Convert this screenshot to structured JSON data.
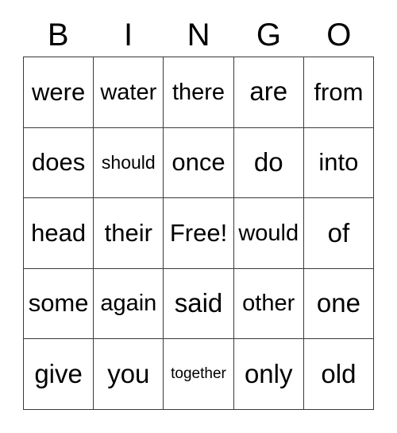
{
  "card": {
    "title": "BINGO",
    "header_letters": [
      "B",
      "I",
      "N",
      "G",
      "O"
    ],
    "free_space_label": "Free!",
    "free_space_position": {
      "row": 2,
      "column": 2
    },
    "grid_size": {
      "rows": 5,
      "columns": 5
    },
    "border_color": "#3a3a3a",
    "text_color": "#000000",
    "background_color": "#ffffff",
    "rows": [
      {
        "cells": [
          {
            "text": "were",
            "size": "lg"
          },
          {
            "text": "water",
            "size": "md"
          },
          {
            "text": "there",
            "size": "md"
          },
          {
            "text": "are",
            "size": "xl"
          },
          {
            "text": "from",
            "size": "lg"
          }
        ]
      },
      {
        "cells": [
          {
            "text": "does",
            "size": "lg"
          },
          {
            "text": "should",
            "size": "sm"
          },
          {
            "text": "once",
            "size": "lg"
          },
          {
            "text": "do",
            "size": "xl"
          },
          {
            "text": "into",
            "size": "lg"
          }
        ]
      },
      {
        "cells": [
          {
            "text": "head",
            "size": "lg"
          },
          {
            "text": "their",
            "size": "lg"
          },
          {
            "text": "Free!",
            "size": "lg"
          },
          {
            "text": "would",
            "size": "md"
          },
          {
            "text": "of",
            "size": "xl"
          }
        ]
      },
      {
        "cells": [
          {
            "text": "some",
            "size": "lg"
          },
          {
            "text": "again",
            "size": "md"
          },
          {
            "text": "said",
            "size": "xl"
          },
          {
            "text": "other",
            "size": "md"
          },
          {
            "text": "one",
            "size": "xl"
          }
        ]
      },
      {
        "cells": [
          {
            "text": "give",
            "size": "xl"
          },
          {
            "text": "you",
            "size": "xl"
          },
          {
            "text": "together",
            "size": "xs"
          },
          {
            "text": "only",
            "size": "xl"
          },
          {
            "text": "old",
            "size": "xl"
          }
        ]
      }
    ]
  }
}
